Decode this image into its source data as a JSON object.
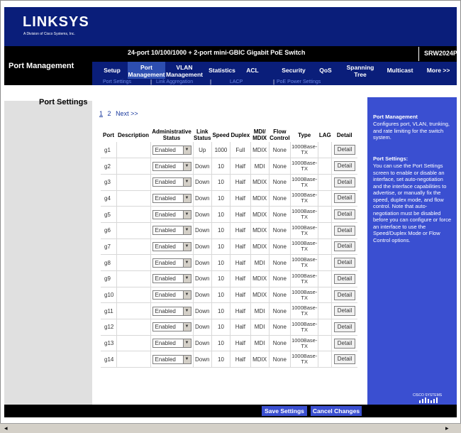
{
  "brand": {
    "logo": "LINKSYS",
    "logo_sub": "A Division of Cisco Systems, Inc."
  },
  "header": {
    "section": "Port Management",
    "product": "24-port 10/100/1000 + 2-port mini-GBIC Gigabit PoE Switch",
    "model": "SRW2024P"
  },
  "tabs": [
    {
      "label": "Setup"
    },
    {
      "label": "Port Management"
    },
    {
      "label": "VLAN Management"
    },
    {
      "label": "Statistics"
    },
    {
      "label": "ACL"
    },
    {
      "label": "Security"
    },
    {
      "label": "QoS"
    },
    {
      "label": "Spanning Tree"
    },
    {
      "label": "Multicast"
    },
    {
      "label": "More >>"
    }
  ],
  "subtabs": [
    {
      "label": "Port Settings"
    },
    {
      "label": "Link Aggregation"
    },
    {
      "label": "LACP"
    },
    {
      "label": "PoE Power Settings"
    }
  ],
  "page": {
    "title": "Port Settings",
    "pager": [
      "1",
      "2",
      "Next >>"
    ]
  },
  "table": {
    "headers": [
      "Port",
      "Description",
      "Administrative Status",
      "Link Status",
      "Speed",
      "Duplex",
      "MDI/ MDIX",
      "Flow Control",
      "Type",
      "LAG",
      "Detail"
    ],
    "rows": [
      {
        "port": "g1",
        "admin": "Enabled",
        "link": "Up",
        "speed": "1000",
        "duplex": "Full",
        "mdi": "MDIX",
        "flow": "None",
        "type": "1000Base-TX",
        "detail": "Detail"
      },
      {
        "port": "g2",
        "admin": "Enabled",
        "link": "Down",
        "speed": "10",
        "duplex": "Half",
        "mdi": "MDI",
        "flow": "None",
        "type": "1000Base-TX",
        "detail": "Detail"
      },
      {
        "port": "g3",
        "admin": "Enabled",
        "link": "Down",
        "speed": "10",
        "duplex": "Half",
        "mdi": "MDIX",
        "flow": "None",
        "type": "1000Base-TX",
        "detail": "Detail"
      },
      {
        "port": "g4",
        "admin": "Enabled",
        "link": "Down",
        "speed": "10",
        "duplex": "Half",
        "mdi": "MDIX",
        "flow": "None",
        "type": "1000Base-TX",
        "detail": "Detail"
      },
      {
        "port": "g5",
        "admin": "Enabled",
        "link": "Down",
        "speed": "10",
        "duplex": "Half",
        "mdi": "MDIX",
        "flow": "None",
        "type": "1000Base-TX",
        "detail": "Detail"
      },
      {
        "port": "g6",
        "admin": "Enabled",
        "link": "Down",
        "speed": "10",
        "duplex": "Half",
        "mdi": "MDIX",
        "flow": "None",
        "type": "1000Base-TX",
        "detail": "Detail"
      },
      {
        "port": "g7",
        "admin": "Enabled",
        "link": "Down",
        "speed": "10",
        "duplex": "Half",
        "mdi": "MDIX",
        "flow": "None",
        "type": "1000Base-TX",
        "detail": "Detail"
      },
      {
        "port": "g8",
        "admin": "Enabled",
        "link": "Down",
        "speed": "10",
        "duplex": "Half",
        "mdi": "MDI",
        "flow": "None",
        "type": "1000Base-TX",
        "detail": "Detail"
      },
      {
        "port": "g9",
        "admin": "Enabled",
        "link": "Down",
        "speed": "10",
        "duplex": "Half",
        "mdi": "MDIX",
        "flow": "None",
        "type": "1000Base-TX",
        "detail": "Detail"
      },
      {
        "port": "g10",
        "admin": "Enabled",
        "link": "Down",
        "speed": "10",
        "duplex": "Half",
        "mdi": "MDIX",
        "flow": "None",
        "type": "1000Base-TX",
        "detail": "Detail"
      },
      {
        "port": "g11",
        "admin": "Enabled",
        "link": "Down",
        "speed": "10",
        "duplex": "Half",
        "mdi": "MDI",
        "flow": "None",
        "type": "1000Base-TX",
        "detail": "Detail"
      },
      {
        "port": "g12",
        "admin": "Enabled",
        "link": "Down",
        "speed": "10",
        "duplex": "Half",
        "mdi": "MDI",
        "flow": "None",
        "type": "1000Base-TX",
        "detail": "Detail"
      },
      {
        "port": "g13",
        "admin": "Enabled",
        "link": "Down",
        "speed": "10",
        "duplex": "Half",
        "mdi": "MDI",
        "flow": "None",
        "type": "1000Base-TX",
        "detail": "Detail"
      },
      {
        "port": "g14",
        "admin": "Enabled",
        "link": "Down",
        "speed": "10",
        "duplex": "Half",
        "mdi": "MDIX",
        "flow": "None",
        "type": "1000Base-TX",
        "detail": "Detail"
      }
    ]
  },
  "help": {
    "title1": "Port Management",
    "text1": "Configures port, VLAN, trunking, and rate limiting for the switch system.",
    "title2": "Port Settings:",
    "text2": "You can use the Port Settings screen to enable or disable an interface, set auto-negotiation and the interface capabilities to advertise, or manually fix the speed, duplex mode, and flow control. Note that auto-negotiation must be disabled before you can configure or force an interface to use the Speed/Duplex Mode or Flow Control options."
  },
  "footer": {
    "save": "Save Settings",
    "cancel": "Cancel Changes",
    "cisco": "CISCO SYSTEMS"
  },
  "colors": {
    "navy": "#0a1e7a",
    "help_blue": "#3a4fd1",
    "link_blue": "#1b3b9e"
  }
}
